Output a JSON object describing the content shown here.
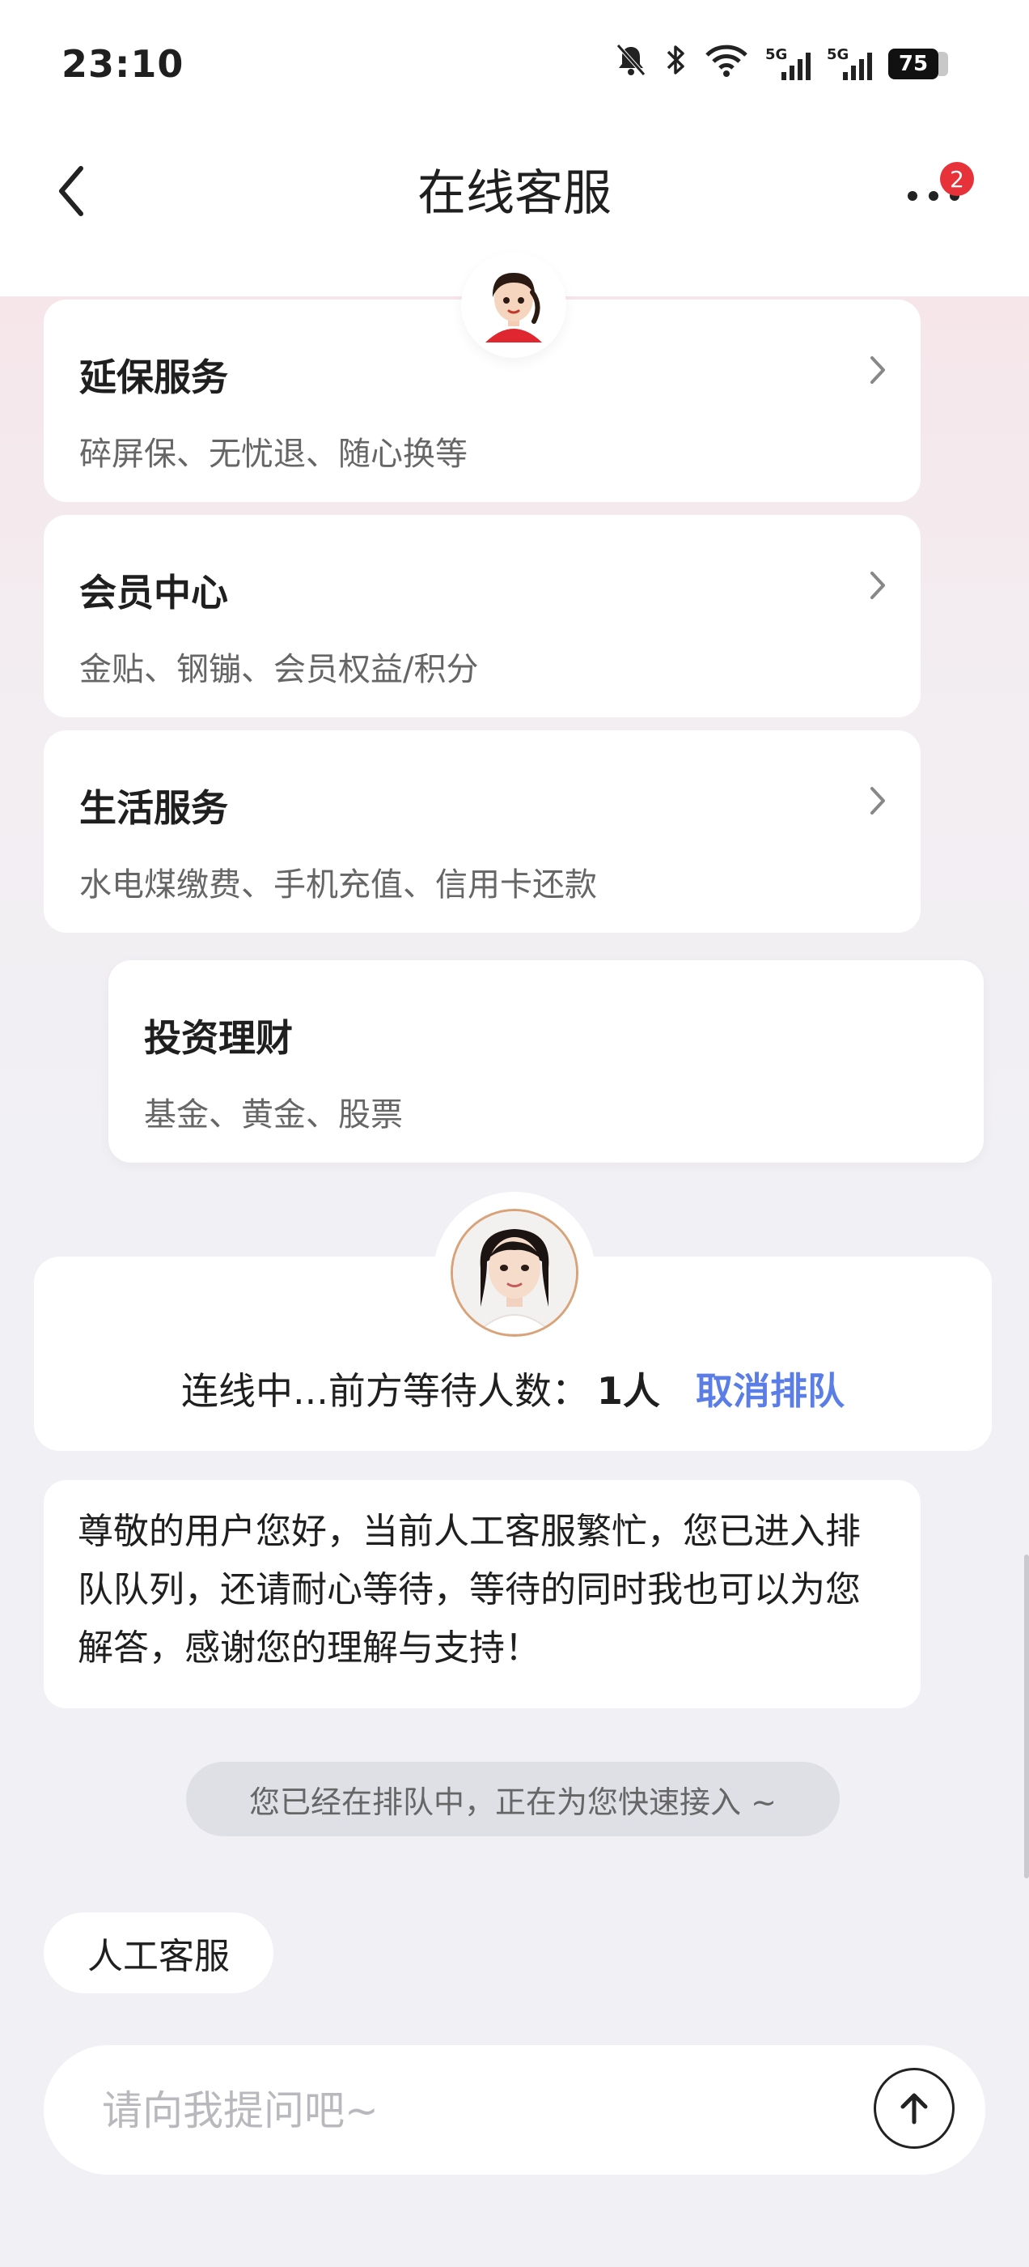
{
  "status_bar": {
    "time": "23:10",
    "network_a": "5G",
    "network_b": "5G",
    "battery": "75"
  },
  "header": {
    "title": "在线客服",
    "notification_count": "2"
  },
  "menu_cards": [
    {
      "title": "延保服务",
      "subtitle": "碎屏保、无忧退、随心换等"
    },
    {
      "title": "会员中心",
      "subtitle": "金贴、钢镚、会员权益/积分"
    },
    {
      "title": "生活服务",
      "subtitle": "水电煤缴费、手机充值、信用卡还款"
    },
    {
      "title": "投资理财",
      "subtitle": "基金、黄金、股票"
    }
  ],
  "queue": {
    "status_text": "连线中...前方等待人数：",
    "count": "1人",
    "cancel_label": "取消排队"
  },
  "message": {
    "text": "尊敬的用户您好，当前人工客服繁忙，您已进入排队队列，还请耐心等待，等待的同时我也可以为您解答，感谢您的理解与支持！"
  },
  "system_notice": "您已经在排队中，正在为您快速接入 ~",
  "quick_chip": "人工客服",
  "input": {
    "placeholder": "请向我提问吧~"
  },
  "colors": {
    "accent": "#5b7de6",
    "badge": "#e8323a",
    "background": "#f1f0f5"
  }
}
